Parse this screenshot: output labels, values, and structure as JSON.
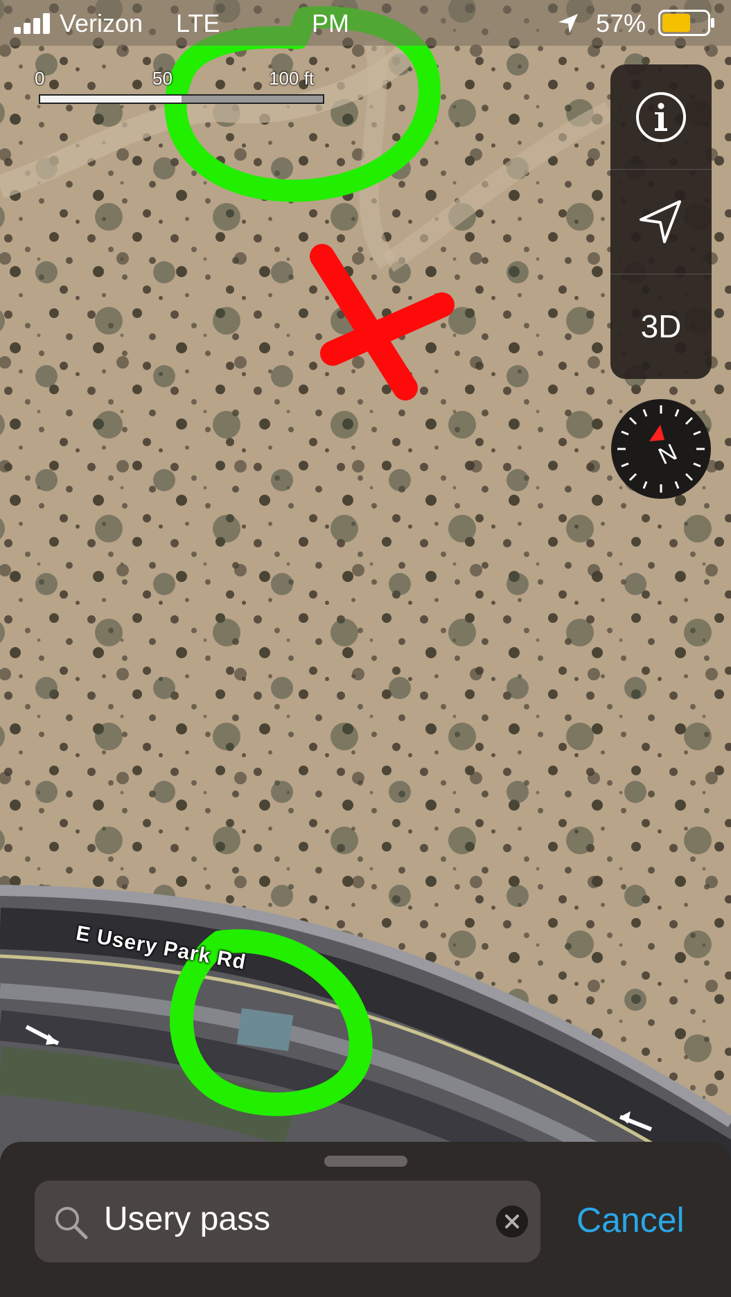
{
  "status_bar": {
    "carrier": "Verizon",
    "network": "LTE",
    "time": "PM",
    "battery_percent": "57%"
  },
  "scale": {
    "tick_0": "0",
    "tick_1": "50",
    "tick_2": "100 ft"
  },
  "map_controls": {
    "info_icon": "info-icon",
    "location_icon": "location-arrow-icon",
    "view_3d_label": "3D",
    "compass_label": "N"
  },
  "map": {
    "road_label": "E Usery Park Rd",
    "annotation_colors": {
      "green_circle": "#22ee00",
      "red_x": "#ff0a0a"
    }
  },
  "search": {
    "query": "Usery pass",
    "cancel_label": "Cancel"
  },
  "colors": {
    "accent": "#2aa7e8",
    "battery": "#f5c000"
  }
}
